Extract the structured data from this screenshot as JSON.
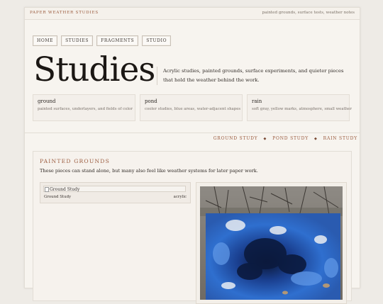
{
  "header": {
    "brand": "PAPER WEATHER STUDIES",
    "note": "painted grounds, surface tests, weather notes"
  },
  "nav": [
    "HOME",
    "STUDIES",
    "FRAGMENTS",
    "STUDIO"
  ],
  "hero": {
    "title": "Studies",
    "description": "Acrylic studies, painted grounds, surface experiments, and quieter pieces that hold the weather behind the work."
  },
  "cards": [
    {
      "title": "ground",
      "subtitle": "painted surfaces, underlayers, and fields of color"
    },
    {
      "title": "pond",
      "subtitle": "cooler studies, blue areas, water-adjacent shapes"
    },
    {
      "title": "rain",
      "subtitle": "soft gray, yellow marks, atmosphere, small weather"
    }
  ],
  "subnav": [
    "GROUND STUDY",
    "POND STUDY",
    "RAIN STUDY"
  ],
  "section": {
    "title": "PAINTED GROUNDS",
    "description": "These pieces can stand alone, but many also feel like weather systems for later paper work.",
    "entry": {
      "image_alt": "Ground Study",
      "name": "Ground Study",
      "medium": "acrylic"
    }
  }
}
